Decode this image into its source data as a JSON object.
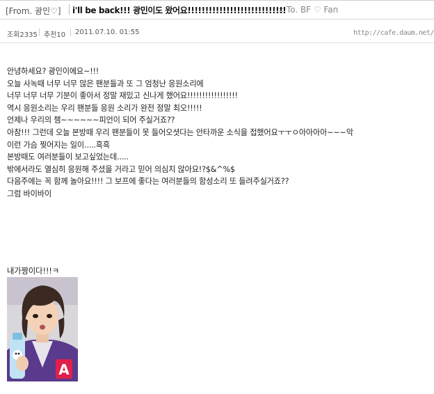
{
  "header": {
    "board": "[From. 광민♡]",
    "title": "i'll be back!!! 광민이도 왔어요!!!!!!!!!!!!!!!!!!!!!!!!!!!!",
    "to": ":: To. BF ♡ Fan"
  },
  "meta": {
    "views_label": "조회",
    "views": "2335",
    "recommend_label": "추천",
    "recommend": "10",
    "datetime": "2011.07.10. 01:55",
    "url": "http://cafe.daum.net/"
  },
  "body": {
    "lines": [
      "안녕하세요? 광민이에요~!!!",
      "오늘 사녹때 너무 너무 많은 팬분들과 또  그 엄청난 응원소리에",
      "너무 너무 너무  기분이 좋아서 정말 재밌고 신나게 했어요!!!!!!!!!!!!!!!!!",
      "역시 응원소리는 우리 팬분들 응원 소리가 완전 정말 최오!!!!!",
      "언제나 우리의 챔~~~~~~피언이 되어 주실거죠??",
      "아참!!! 그런데 오늘 본방때 우리 팬분들이 못 들어오셧다는 안타까운 소식을 접했어요ㅜㅜㅇ아아아아~~~악",
      "이런 가슴 찢어지는 일이.....흑흑",
      "본방때도 여러분들이 보고싶었는데.....",
      "밖에서라도 열심히 응원해 주셨을 거라고 믿어 의심치 않아요!?$&^%$",
      "다음주에는 꼭 함께 놀아요!!!! 그 보프에 좋다는 여러분들의 함성소리 또 들려주실거죠??",
      "그럼 바이바이"
    ],
    "signoff": "내가짱이다!!!ㅋ"
  },
  "photo": {
    "icon": "person-photo",
    "colors": {
      "background": "#d9d6dc",
      "hair": "#3a2a22",
      "skin": "#f3d2b8",
      "jacket": "#5a3a8c",
      "bottle": "#bfe3f4",
      "badge": "#e0204a"
    }
  }
}
